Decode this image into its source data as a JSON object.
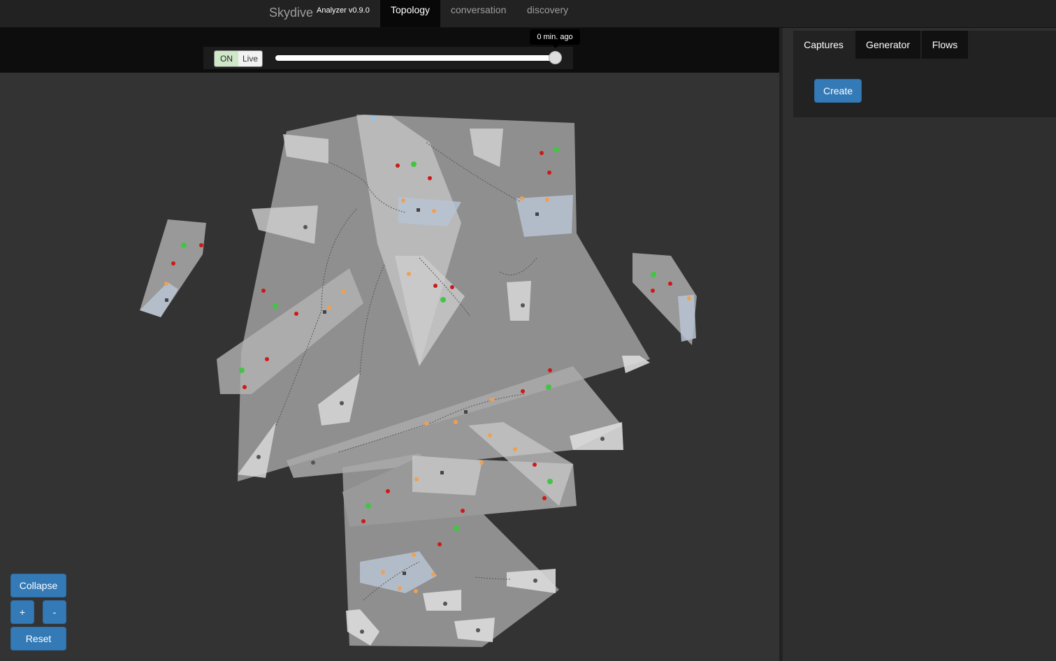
{
  "navbar": {
    "brand": "Skydive",
    "version": "Analyzer v0.9.0",
    "tabs": [
      {
        "label": "Topology",
        "active": true
      },
      {
        "label": "conversation",
        "active": false
      },
      {
        "label": "discovery",
        "active": false
      }
    ]
  },
  "timeline": {
    "toggle_on": "ON",
    "toggle_label": "Live",
    "tooltip": "0 min. ago",
    "slider_value": 1.0
  },
  "controls": {
    "collapse": "Collapse",
    "zoom_in": "+",
    "zoom_out": "-",
    "reset": "Reset"
  },
  "right_panel": {
    "tabs": [
      {
        "label": "Captures",
        "active": true
      },
      {
        "label": "Generator",
        "active": false
      },
      {
        "label": "Flows",
        "active": false
      }
    ],
    "create_button": "Create"
  },
  "colors": {
    "accent": "#337ab7",
    "group_fill": "#dddddd",
    "node_blue": "#8cc6f0",
    "node_orange": "#f0a050",
    "node_red": "#d01818",
    "node_green": "#44c444"
  }
}
